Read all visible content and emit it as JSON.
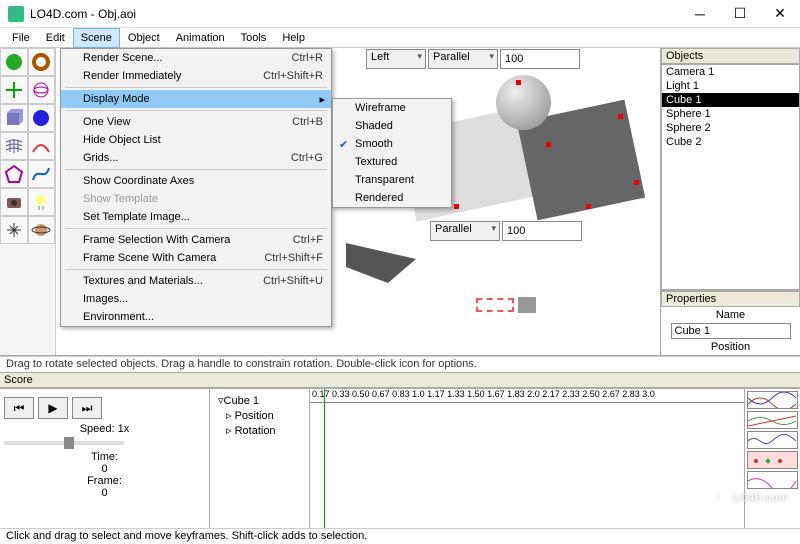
{
  "title": "LO4D.com - Obj.aoi",
  "menubar": [
    "File",
    "Edit",
    "Scene",
    "Object",
    "Animation",
    "Tools",
    "Help"
  ],
  "scene_menu": [
    {
      "label": "Render Scene...",
      "shortcut": "Ctrl+R"
    },
    {
      "label": "Render Immediately",
      "shortcut": "Ctrl+Shift+R"
    },
    {
      "sep": true
    },
    {
      "label": "Display Mode",
      "submenu": true,
      "highlight": true
    },
    {
      "sep": true
    },
    {
      "label": "One View",
      "shortcut": "Ctrl+B"
    },
    {
      "label": "Hide Object List"
    },
    {
      "label": "Grids...",
      "shortcut": "Ctrl+G"
    },
    {
      "sep": true
    },
    {
      "label": "Show Coordinate Axes"
    },
    {
      "label": "Show Template",
      "disabled": true
    },
    {
      "label": "Set Template Image..."
    },
    {
      "sep": true
    },
    {
      "label": "Frame Selection With Camera",
      "shortcut": "Ctrl+F"
    },
    {
      "label": "Frame Scene With Camera",
      "shortcut": "Ctrl+Shift+F"
    },
    {
      "sep": true
    },
    {
      "label": "Textures and Materials...",
      "shortcut": "Ctrl+Shift+U"
    },
    {
      "label": "Images..."
    },
    {
      "label": "Environment..."
    }
  ],
  "display_mode_menu": [
    "Wireframe",
    "Shaded",
    "Smooth",
    "Textured",
    "Transparent",
    "Rendered"
  ],
  "display_mode_selected": "Smooth",
  "viewport_top": {
    "view": "Left",
    "proj": "Parallel",
    "zoom": "100"
  },
  "viewport_bottom": {
    "view": "",
    "proj": "Parallel",
    "zoom": "100"
  },
  "objects_header": "Objects",
  "objects": [
    "Camera 1",
    "Light 1",
    "Cube 1",
    "Sphere 1",
    "Sphere 2",
    "Cube 2"
  ],
  "object_selected": "Cube 1",
  "properties_header": "Properties",
  "prop_name_label": "Name",
  "prop_name_value": "Cube 1",
  "prop_position_label": "Position",
  "status1": "Drag to rotate selected objects.  Drag a handle to constrain rotation.  Double-click icon for options.",
  "score_header": "Score",
  "speed_label": "Speed: 1x",
  "time_label": "Time:",
  "time_value": "0",
  "frame_label": "Frame:",
  "frame_value": "0",
  "tree": {
    "root": "Cube 1",
    "children": [
      "Position",
      "Rotation"
    ]
  },
  "ruler": "0.17 0.33 0.50 0.67 0.83 1.0 1.17 1.33 1.50 1.67 1.83 2.0 2.17 2.33 2.50 2.67 2.83 3.0",
  "status2": "Click and drag to select and move keyframes.  Shift-click adds to selection.",
  "watermark": "LO4D.com"
}
